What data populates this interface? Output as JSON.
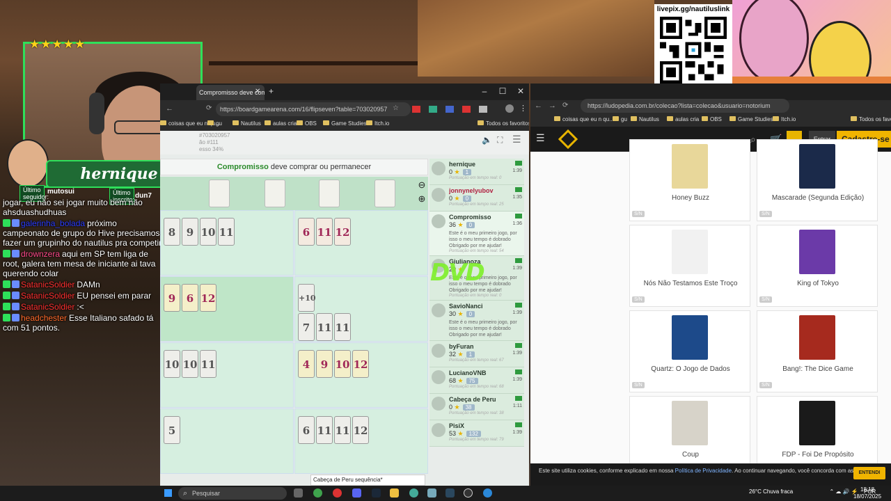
{
  "stream": {
    "streamer_name": "hernique",
    "last_follower_label": "Último seguidor:",
    "last_follower": "mutosui",
    "last_sub_label": "Último inscrito:",
    "last_sub": "dun7",
    "rating_stars": "★★★★★",
    "qr_label": "livepix.gg/nautiluslink",
    "dvd_logo": "DVD"
  },
  "chat": [
    {
      "user": "",
      "text": "jogar, eu não sei jogar muito bem não ahsduashudhuas"
    },
    {
      "user": "galerinha_bolada",
      "text": "próximo campeonato de grupo do Hive precisamos fazer um grupinho do nautilus pra competir"
    },
    {
      "user": "drownzera",
      "text": "aqui em SP tem liga de root, galera tem mesa de iniciante ai tava querendo colar"
    },
    {
      "user": "SatanicSoldier",
      "text": "DAMn"
    },
    {
      "user": "SatanicSoldier",
      "text": "EU pensei em parar"
    },
    {
      "user": "SatanicSoldier",
      "text": ":<"
    },
    {
      "user": "headchester",
      "text": "Esse Italiano safado tá com 51 pontos."
    }
  ],
  "left_browser": {
    "tab_title": "Compromisso deve comprar ou...",
    "url": "https://boardgamearena.com/16/flipseven?table=703020957",
    "bookmarks": [
      "coisas que eu n qu...",
      "gu",
      "Nautilus",
      "aulas cria",
      "OBS",
      "Game Studies",
      "Itch.io",
      "Todos os favoritos"
    ],
    "game_table": "#703020957",
    "game_turn": "ão #111",
    "game_progress": "esso 34%",
    "status_player": "Compromisso",
    "status_text": "deve comprar ou permanecer",
    "tooltip": "Cabeça de Peru sequência*"
  },
  "players": [
    {
      "name": "hernique",
      "score": "0",
      "bust": "1",
      "time": "1:39",
      "note": "",
      "rt": "Pontuação em tempo real: 0",
      "name_red": false,
      "active": false
    },
    {
      "name": "jonnynelyubov",
      "score": "0",
      "bust": "0",
      "time": "1:35",
      "note": "",
      "rt": "Pontuação em tempo real: 25",
      "name_red": true,
      "active": false
    },
    {
      "name": "Compromisso",
      "score": "36",
      "bust": "0",
      "time": "1:36",
      "note": "Este é o meu primeiro jogo, por isso o meu tempo é dobrado Obrigado por me ajudar!",
      "rt": "Pontuação em tempo real: 54",
      "name_red": false,
      "active": true
    },
    {
      "name": "Giulianoza",
      "score": "29",
      "bust": "",
      "time": "1:39",
      "note": "Este é o meu primeiro jogo, por isso o meu tempo é dobrado Obrigado por me ajudar!",
      "rt": "Pontuação em tempo real: 0",
      "name_red": false,
      "active": false
    },
    {
      "name": "SavioNanci",
      "score": "30",
      "bust": "0",
      "time": "1:39",
      "note": "Este é o meu primeiro jogo, por isso o meu tempo é dobrado Obrigado por me ajudar!",
      "rt": "",
      "name_red": false,
      "active": false
    },
    {
      "name": "byFuran",
      "score": "32",
      "bust": "1",
      "time": "1:39",
      "note": "",
      "rt": "Pontuação em tempo real: 67",
      "name_red": false,
      "active": false
    },
    {
      "name": "LucianoVNB",
      "score": "68",
      "bust": "75",
      "time": "1:39",
      "note": "",
      "rt": "Pontuação em tempo real: 68",
      "name_red": false,
      "active": false
    },
    {
      "name": "Cabeça de Peru",
      "score": "0",
      "bust": "38",
      "time": "1:11",
      "note": "",
      "rt": "Pontuação em tempo real: 38",
      "name_red": false,
      "active": false
    },
    {
      "name": "PisiX",
      "score": "53",
      "bust": "132",
      "time": "1:39",
      "note": "",
      "rt": "Pontuação em tempo real: 79",
      "name_red": false,
      "active": false
    }
  ],
  "boards": [
    {
      "cards": [
        "8",
        "9",
        "10",
        "11"
      ],
      "pink": false
    },
    {
      "cards": [
        "6",
        "11",
        "12"
      ],
      "pink": true
    },
    {
      "cards": [
        "9",
        "6",
        "12"
      ],
      "pink": true
    },
    {
      "cards": [
        "+10",
        "7",
        "11",
        "11"
      ],
      "pink": false
    },
    {
      "cards": [
        "10",
        "10",
        "11"
      ],
      "pink": false
    },
    {
      "cards": [
        "4",
        "9",
        "10",
        "12"
      ],
      "pink": true
    },
    {
      "cards": [
        "5"
      ],
      "pink": false
    },
    {
      "cards": [
        "6",
        "11",
        "11",
        "12"
      ],
      "pink": false
    }
  ],
  "right_browser": {
    "url": "https://ludopedia.com.br/colecao?lista=colecao&usuario=notorium",
    "bookmarks": [
      "coisas que eu n qu...",
      "gu",
      "Nautilus",
      "aulas cria",
      "OBS",
      "Game Studies",
      "Itch.io",
      "Todos os favorit"
    ],
    "entrar": "Entrar",
    "cadastre": "Cadastre-se",
    "games": [
      {
        "title": "Honey Buzz",
        "sn": "S/N",
        "cover": "#e8d79a"
      },
      {
        "title": "Mascarade (Segunda Edição)",
        "sn": "S/N",
        "cover": "#1b2a4a"
      },
      {
        "title": "Nós Não Testamos Este Troço",
        "sn": "S/N",
        "cover": "#f1f1f1"
      },
      {
        "title": "King of Tokyo",
        "sn": "S/N",
        "cover": "#6b3aa8"
      },
      {
        "title": "Quartz: O Jogo de Dados",
        "sn": "S/N",
        "cover": "#1d4a8a"
      },
      {
        "title": "Bang!: The Dice Game",
        "sn": "S/N",
        "cover": "#a62a1e"
      },
      {
        "title": "Coup",
        "sn": "",
        "cover": "#d7d3c9"
      },
      {
        "title": "FDP - Foi De Propósito",
        "sn": "",
        "cover": "#1a1a1a"
      }
    ],
    "cookie_text_1": "Este site utiliza cookies, conforme explicado em nossa",
    "cookie_link": "Política de Privacidade",
    "cookie_text_2": ". Ao continuar navegando, você concorda com as condições.",
    "cookie_button": "ENTENDI"
  },
  "taskbar": {
    "search": "Pesquisar",
    "weather": "26°C Chuva fraca",
    "lang": "POR",
    "time": "18:18",
    "date": "18/07/2025"
  }
}
